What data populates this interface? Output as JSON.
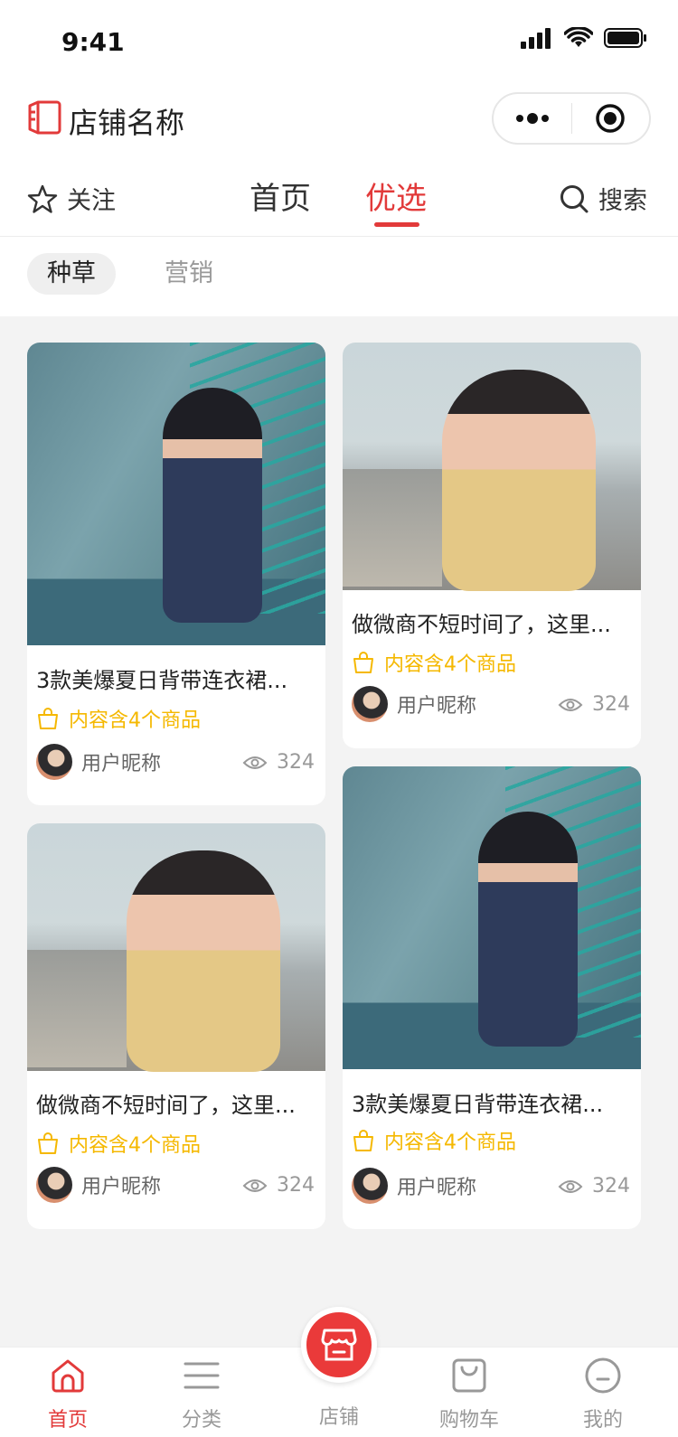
{
  "status": {
    "time": "9:41"
  },
  "header": {
    "store_name": "店铺名称"
  },
  "tabs": {
    "follow": "关注",
    "home": "首页",
    "pick": "优选",
    "search": "搜索"
  },
  "sub_tabs": [
    "种草",
    "营销"
  ],
  "cards": [
    {
      "title": "3款美爆夏日背带连衣裙...",
      "goods": "内容含4个商品",
      "user": "用户昵称",
      "views": "324"
    },
    {
      "title": "做微商不短时间了，这里...",
      "goods": "内容含4个商品",
      "user": "用户昵称",
      "views": "324"
    },
    {
      "title": "做微商不短时间了，这里...",
      "goods": "内容含4个商品",
      "user": "用户昵称",
      "views": "324"
    },
    {
      "title": "3款美爆夏日背带连衣裙...",
      "goods": "内容含4个商品",
      "user": "用户昵称",
      "views": "324"
    }
  ],
  "tabbar": [
    "首页",
    "分类",
    "店铺",
    "购物车",
    "我的"
  ],
  "colors": {
    "accent": "#e23a3a",
    "goods": "#f5b800"
  }
}
